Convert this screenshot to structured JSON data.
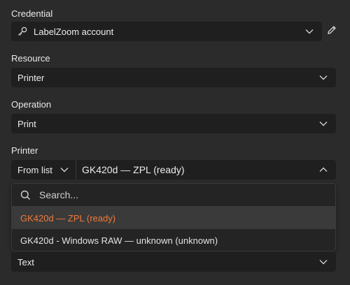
{
  "credential": {
    "label": "Credential",
    "value": "LabelZoom account",
    "key_icon": "key-icon",
    "edit_icon": "pencil-icon"
  },
  "resource": {
    "label": "Resource",
    "value": "Printer"
  },
  "operation": {
    "label": "Operation",
    "value": "Print"
  },
  "printer": {
    "label": "Printer",
    "mode": "From list",
    "value": "GK420d — ZPL (ready)"
  },
  "dropdown": {
    "search_placeholder": "Search...",
    "options": [
      {
        "label": "GK420d — ZPL (ready)",
        "selected": true
      },
      {
        "label": "GK420d - Windows RAW — unknown (unknown)",
        "selected": false
      }
    ]
  },
  "format_field": {
    "value": "Text"
  },
  "colors": {
    "background": "#2b2b2b",
    "field": "#1f1f1f",
    "accent": "#f07a3a"
  }
}
